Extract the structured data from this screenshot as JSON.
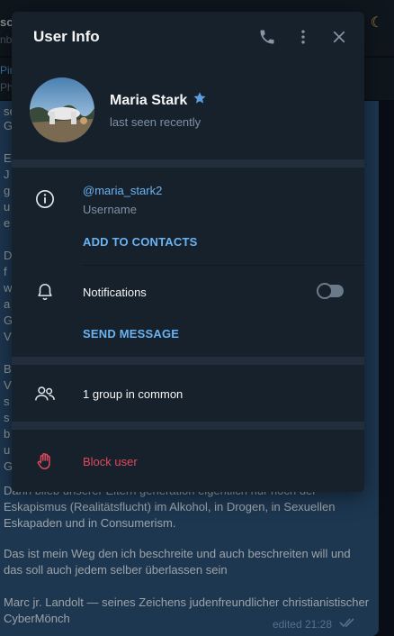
{
  "background_chat": {
    "header_title": "sc",
    "header_subtitle": "nb",
    "pinned_title": "Pin",
    "pinned_subtitle": "Ph",
    "fragments": [
      "se",
      "G",
      "E",
      "J",
      "g",
      "u",
      "e",
      "D",
      "f",
      "w",
      "a",
      "G",
      "V",
      "B",
      "V",
      "s",
      "s",
      "b",
      "u",
      "G"
    ],
    "paragraph_1": "Dann blieb unserer Eltern generation eigentlich nur noch der Eskapismus (Realitätsflucht) im Alkohol, in Drogen, in Sexuellen Eskapaden und in Consumerism.",
    "paragraph_2": "Das ist mein Weg den ich beschreite und auch beschreiten will und das soll auch jedem selber überlassen sein",
    "paragraph_3": "Marc jr. Landolt — seines Zeichens judenfreundlicher christianistischer CyberMönch",
    "meta_edited": "edited 21:28"
  },
  "dialog": {
    "title": "User Info",
    "header_icons": [
      "phone-icon",
      "more-vertical-icon",
      "close-icon"
    ],
    "profile": {
      "name": "Maria Stark",
      "status": "last seen recently",
      "premium_icon": "star-icon"
    },
    "info": {
      "username": "@maria_stark2",
      "username_label": "Username",
      "add_contacts": "ADD TO CONTACTS"
    },
    "notifications": {
      "label": "Notifications",
      "enabled": false,
      "send_message": "SEND MESSAGE"
    },
    "groups": {
      "label": "1 group in common"
    },
    "block": {
      "label": "Block user"
    }
  },
  "colors": {
    "dialog_bg": "#17212b",
    "accent": "#6ab3f3",
    "danger": "#e0495b",
    "separator": "#232e3c",
    "bubble": "#2b5278"
  }
}
